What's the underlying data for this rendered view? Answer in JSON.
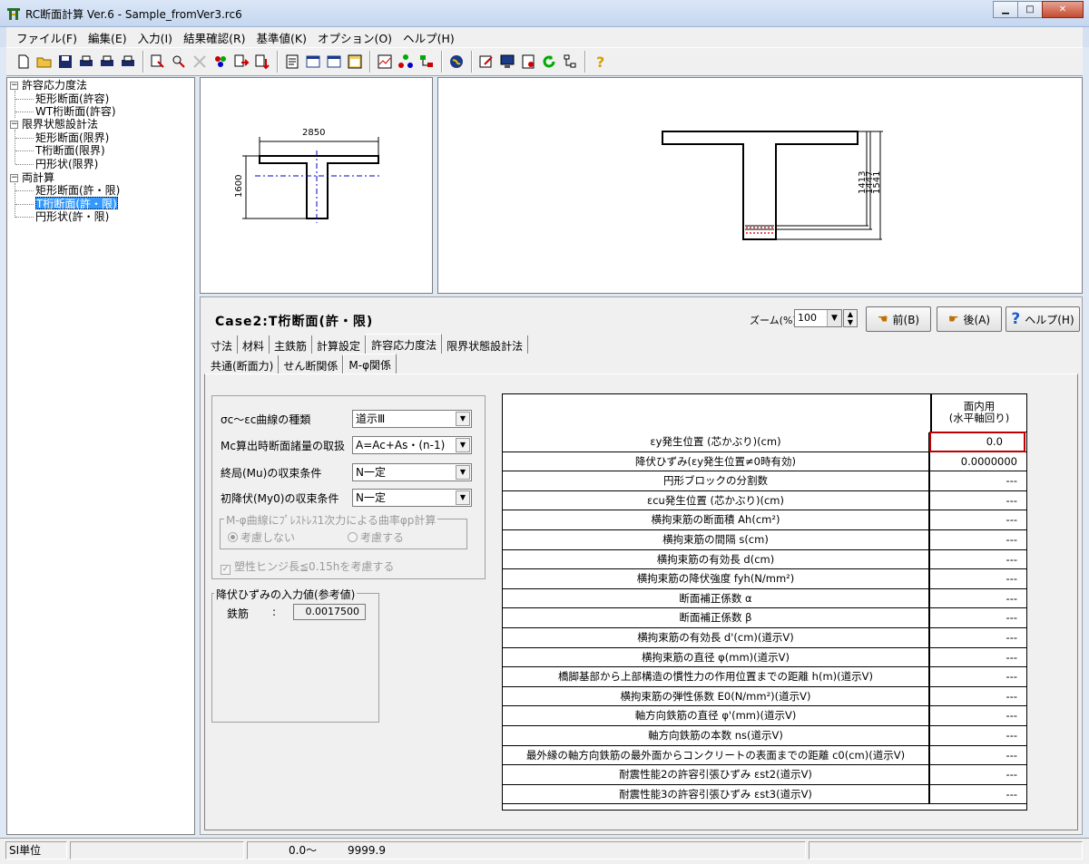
{
  "window": {
    "title": "RC断面計算 Ver.6 - Sample_fromVer3.rc6",
    "controls": [
      "minimize",
      "maximize",
      "close"
    ]
  },
  "menu": [
    "ファイル(F)",
    "編集(E)",
    "入力(I)",
    "結果確認(R)",
    "基準値(K)",
    "オプション(O)",
    "ヘルプ(H)"
  ],
  "tree": {
    "groups": [
      {
        "label": "許容応力度法",
        "items": [
          "矩形断面(許容)",
          "WT桁断面(許容)"
        ]
      },
      {
        "label": "限界状態設計法",
        "items": [
          "矩形断面(限界)",
          "T桁断面(限界)",
          "円形状(限界)"
        ]
      },
      {
        "label": "両計算",
        "items": [
          "矩形断面(許・限)",
          "T桁断面(許・限)",
          "円形状(許・限)"
        ]
      }
    ],
    "selected": "T桁断面(許・限)"
  },
  "drawing": {
    "width_label": "2850",
    "height_label": "1600",
    "dim_labels": [
      "1413",
      "1447",
      "1541"
    ]
  },
  "case_title": "Case2:T桁断面(許・限)",
  "zoom": {
    "label": "ズーム(%)",
    "value": "100"
  },
  "buttons": {
    "prev": "前(B)",
    "next": "後(A)",
    "help": "ヘルプ(H)"
  },
  "tabs_main": [
    "寸法",
    "材料",
    "主鉄筋",
    "計算設定",
    "許容応力度法",
    "限界状態設計法"
  ],
  "tabs_main_active": "許容応力度法",
  "tabs_sub": [
    "共通(断面力)",
    "せん断関係",
    "M-φ関係"
  ],
  "tabs_sub_active": "M-φ関係",
  "form": {
    "curve_type": {
      "label": "σc～εc曲線の種類",
      "value": "道示Ⅲ"
    },
    "mc_section": {
      "label": "Mc算出時断面諸量の取扱",
      "value": "A=Ac+As・(n-1)"
    },
    "ultimate": {
      "label": "終局(Mu)の収束条件",
      "value": "N一定"
    },
    "yield_init": {
      "label": "初降伏(My0)の収束条件",
      "value": "N一定"
    },
    "prestress_group": {
      "legend": "M-φ曲線にﾌﾟﾚｽﾄﾚｽ1次力による曲率φp計算",
      "option_off": "考慮しない",
      "option_on": "考慮する",
      "selected": "考慮しない"
    },
    "hinge_check": {
      "label": "塑性ヒンジ長≦0.15hを考慮する",
      "checked": true
    },
    "yield_strain_group": {
      "legend": "降伏ひずみの入力値(参考値)",
      "label": "鉄筋",
      "colon": ":",
      "value": "0.0017500"
    }
  },
  "grid": {
    "header": "面内用\n(水平軸回り)",
    "rows": [
      {
        "label": "εy発生位置 (芯かぶり)(cm)",
        "value": "0.0"
      },
      {
        "label": "降伏ひずみ(εy発生位置≠0時有効)",
        "value": "0.0000000"
      },
      {
        "label": "円形ブロックの分割数",
        "value": "---"
      },
      {
        "label": "εcu発生位置 (芯かぶり)(cm)",
        "value": "---"
      },
      {
        "label": "横拘束筋の断面積 Ah(cm²)",
        "value": "---"
      },
      {
        "label": "横拘束筋の間隔 s(cm)",
        "value": "---"
      },
      {
        "label": "横拘束筋の有効長 d(cm)",
        "value": "---"
      },
      {
        "label": "横拘束筋の降伏強度 fyh(N/mm²)",
        "value": "---"
      },
      {
        "label": "断面補正係数 α",
        "value": "---"
      },
      {
        "label": "断面補正係数 β",
        "value": "---"
      },
      {
        "label": "横拘束筋の有効長 d'(cm)(道示Ⅴ)",
        "value": "---"
      },
      {
        "label": "横拘束筋の直径 φ(mm)(道示Ⅴ)",
        "value": "---"
      },
      {
        "label": "橋脚基部から上部構造の慣性力の作用位置までの距離 h(m)(道示Ⅴ)",
        "value": "---"
      },
      {
        "label": "横拘束筋の弾性係数 E0(N/mm²)(道示Ⅴ)",
        "value": "---"
      },
      {
        "label": "軸方向鉄筋の直径 φ'(mm)(道示Ⅴ)",
        "value": "---"
      },
      {
        "label": "軸方向鉄筋の本数 ns(道示Ⅴ)",
        "value": "---"
      },
      {
        "label": "最外縁の軸方向鉄筋の最外面からコンクリートの表面までの距離 c0(cm)(道示Ⅴ)",
        "value": "---"
      },
      {
        "label": "耐震性能2の許容引張ひずみ εst2(道示Ⅴ)",
        "value": "---"
      },
      {
        "label": "耐震性能3の許容引張ひずみ εst3(道示Ⅴ)",
        "value": "---"
      }
    ]
  },
  "status": {
    "units": "SI単位",
    "range": "0.0～",
    "range_max": "9999.9"
  },
  "colors": {
    "selection": "#3399ff",
    "highlight_border": "#c00000",
    "axis_line": "#0000cc"
  }
}
